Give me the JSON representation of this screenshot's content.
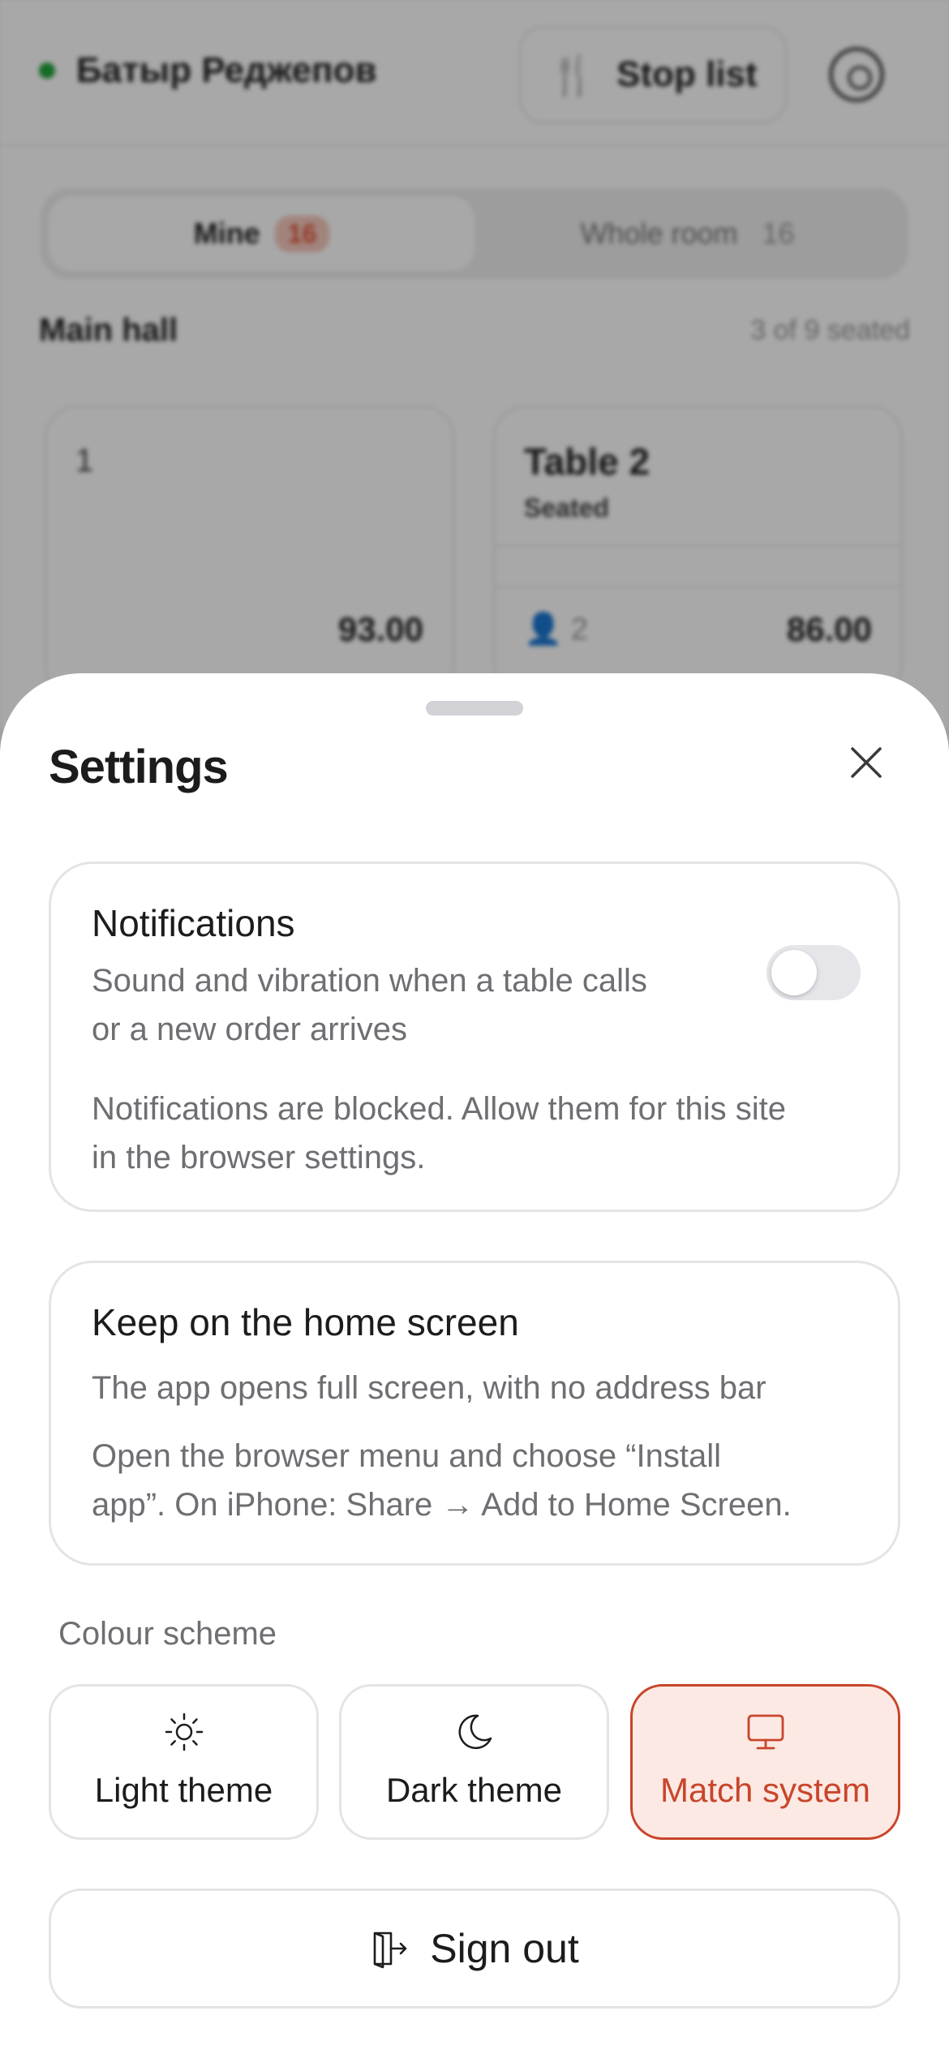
{
  "background": {
    "user_name": "Батыр Реджепов",
    "status_color": "#22a33a",
    "stop_list_label": "Stop list",
    "segments": [
      {
        "label": "Mine",
        "count": "16"
      },
      {
        "label": "Whole room",
        "count": "16"
      }
    ],
    "badge_color": "#f5c9bd",
    "section": {
      "title": "Main hall",
      "meta": "3 of 9 seated"
    },
    "tables": [
      {
        "title": "1",
        "subtitle": "",
        "guests": "",
        "amount": "93.00"
      },
      {
        "title": "Table 2",
        "subtitle": "Seated",
        "guests": "2",
        "amount": "86.00"
      }
    ]
  },
  "sheet": {
    "title": "Settings",
    "close_icon": "close-icon"
  },
  "notifications": {
    "title": "Notifications",
    "description_line1": "Sound and vibration when a table calls",
    "description_line2": "or a new order arrives",
    "blocked_line1": "Notifications are blocked. Allow them for this site",
    "blocked_line2": "in the browser settings.",
    "enabled": false
  },
  "home_screen": {
    "title": "Keep on the home screen",
    "description": "The app opens full screen, with no address bar",
    "instructions_line1": "Open the browser menu and choose “Install",
    "instructions_line2": "app”. On iPhone: Share → Add to Home Screen."
  },
  "colour_scheme": {
    "label": "Colour scheme",
    "options": [
      {
        "label": "Light theme",
        "icon": "sun-icon"
      },
      {
        "label": "Dark theme",
        "icon": "moon-icon"
      },
      {
        "label": "Match system",
        "icon": "monitor-icon"
      }
    ],
    "selected": "Match system",
    "accent_color": "#c8452b",
    "accent_bg": "#fde9e3"
  },
  "sign_out": {
    "label": "Sign out",
    "icon": "sign-out-icon"
  }
}
